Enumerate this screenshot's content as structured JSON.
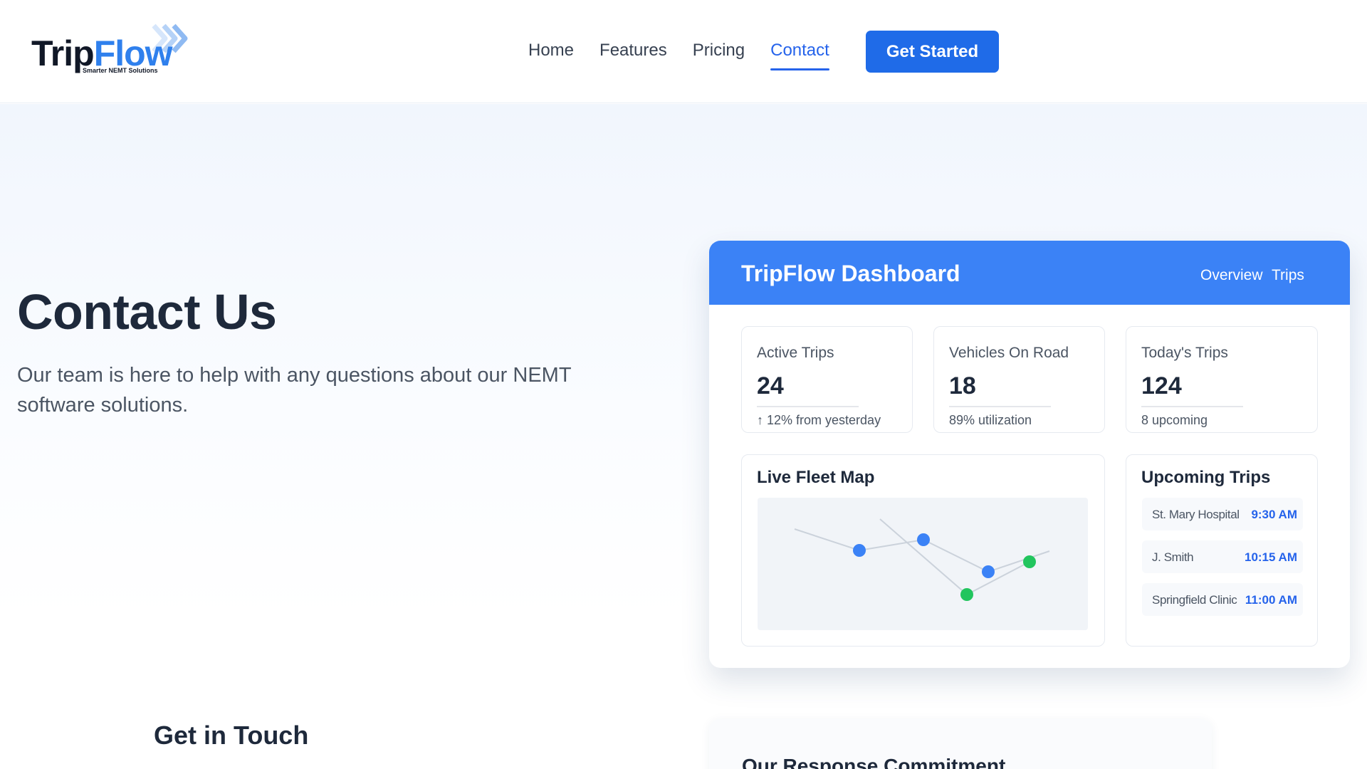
{
  "brand": {
    "logo_primary": "Trip",
    "logo_accent": "Flow",
    "tagline": "Smarter NEMT Solutions",
    "accent_color": "#2f80ed"
  },
  "nav": {
    "links": [
      {
        "label": "Home",
        "active": false
      },
      {
        "label": "Features",
        "active": false
      },
      {
        "label": "Pricing",
        "active": false
      },
      {
        "label": "Contact",
        "active": true
      }
    ],
    "cta_label": "Get Started"
  },
  "hero": {
    "title": "Contact Us",
    "subtitle": "Our team is here to help with any questions about our NEMT software solutions."
  },
  "dashboard": {
    "title": "TripFlow Dashboard",
    "tabs": [
      "Overview",
      "Trips"
    ],
    "stats": [
      {
        "label": "Active Trips",
        "value": "24",
        "note": "↑ 12% from yesterday"
      },
      {
        "label": "Vehicles On Road",
        "value": "18",
        "note": "89% utilization"
      },
      {
        "label": "Today's Trips",
        "value": "124",
        "note": "8 upcoming"
      }
    ],
    "map": {
      "title": "Live Fleet Map",
      "colors": {
        "vehicle_blue": "#3b82f6",
        "vehicle_green": "#22c55e",
        "route": "#cbd2db"
      }
    },
    "upcoming": {
      "title": "Upcoming Trips",
      "items": [
        {
          "name": "St. Mary Hospital",
          "time": "9:30 AM"
        },
        {
          "name": "J. Smith",
          "time": "10:15 AM"
        },
        {
          "name": "Springfield Clinic",
          "time": "11:00 AM"
        }
      ]
    }
  },
  "get_in_touch": {
    "title": "Get in Touch"
  },
  "commitment": {
    "title": "Our Response Commitment"
  }
}
